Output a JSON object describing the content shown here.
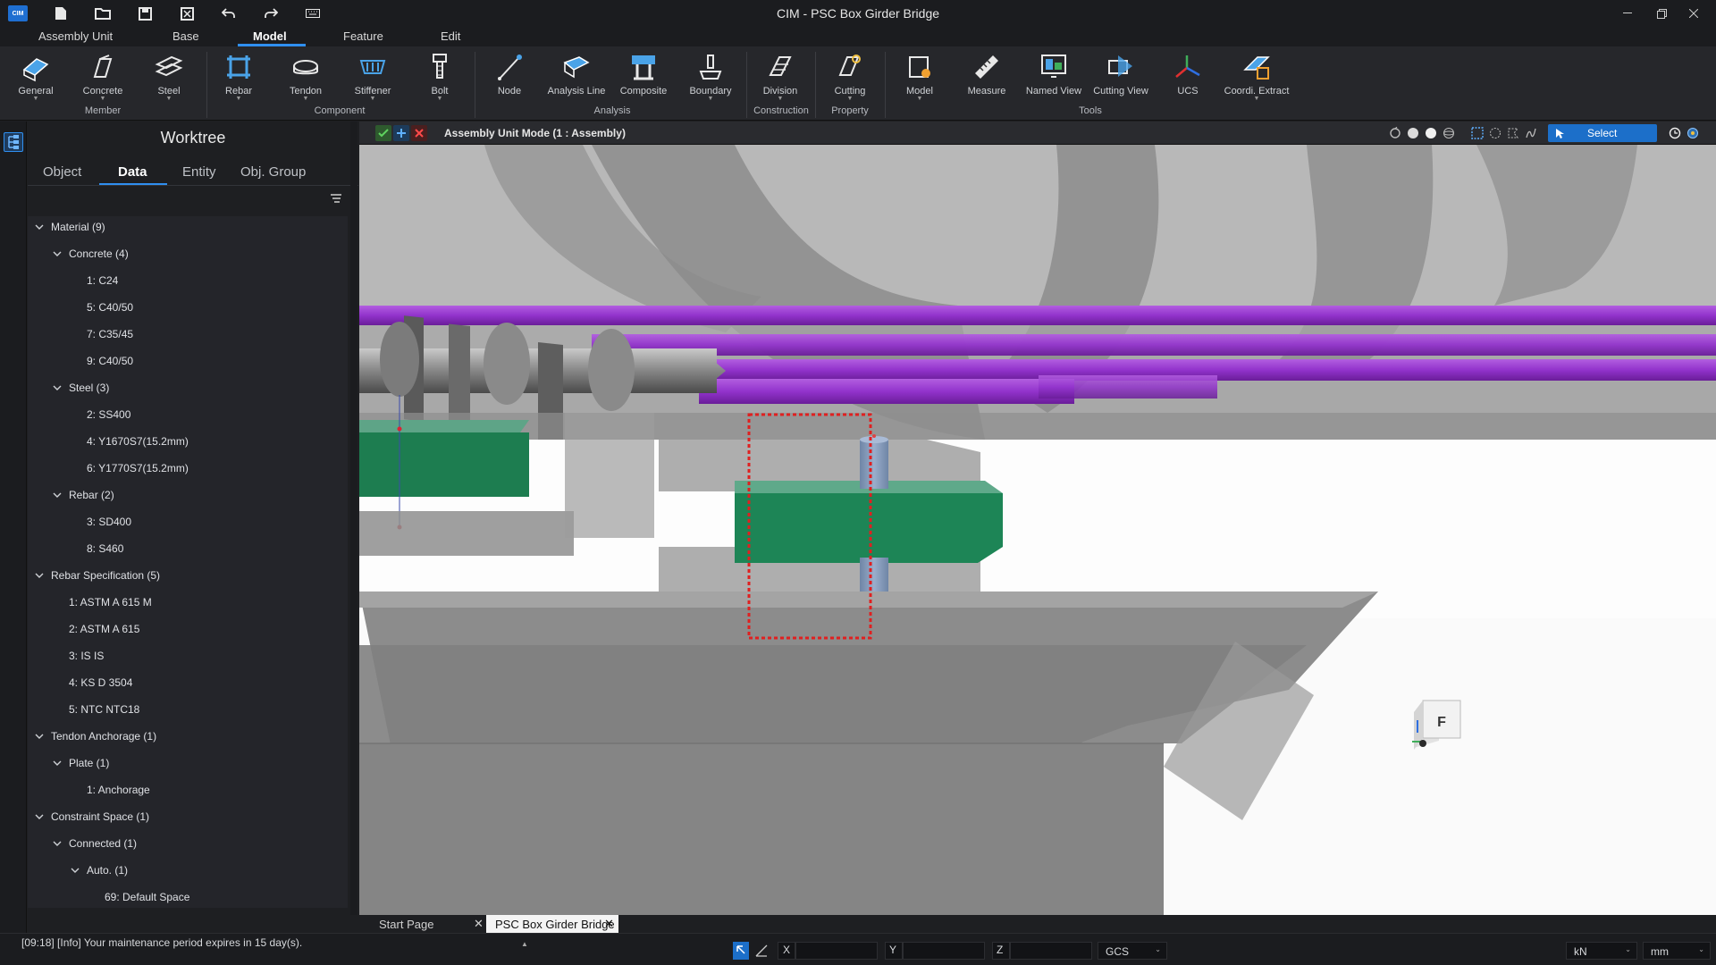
{
  "app": {
    "title": "CIM - PSC Box Girder Bridge",
    "logo": "CIM"
  },
  "menu": {
    "tabs": [
      "Assembly Unit",
      "Base",
      "Model",
      "Feature",
      "Edit"
    ],
    "active": "Model"
  },
  "ribbon": {
    "buttons": [
      "General",
      "Concrete",
      "Steel",
      "Rebar",
      "Tendon",
      "Stiffener",
      "Bolt",
      "Node",
      "Analysis Line",
      "Composite",
      "Boundary",
      "Division",
      "Cutting",
      "Model",
      "Measure",
      "Named View",
      "Cutting View",
      "UCS",
      "Coordi. Extract"
    ],
    "groups": [
      "Member",
      "Component",
      "Analysis",
      "Construction",
      "Property",
      "Tools"
    ]
  },
  "worktree": {
    "title": "Worktree",
    "tabs": [
      "Object",
      "Data",
      "Entity",
      "Obj. Group"
    ],
    "active_tab": "Data",
    "items": [
      {
        "label": "Material (9)",
        "level": 0,
        "expanded": true
      },
      {
        "label": "Concrete (4)",
        "level": 1,
        "expanded": true
      },
      {
        "label": "1: C24",
        "level": 2
      },
      {
        "label": "5: C40/50",
        "level": 2
      },
      {
        "label": "7: C35/45",
        "level": 2
      },
      {
        "label": "9: C40/50",
        "level": 2
      },
      {
        "label": "Steel (3)",
        "level": 1,
        "expanded": true
      },
      {
        "label": "2: SS400",
        "level": 2
      },
      {
        "label": "4: Y1670S7(15.2mm)",
        "level": 2
      },
      {
        "label": "6: Y1770S7(15.2mm)",
        "level": 2
      },
      {
        "label": "Rebar (2)",
        "level": 1,
        "expanded": true
      },
      {
        "label": "3: SD400",
        "level": 2
      },
      {
        "label": "8: S460",
        "level": 2
      },
      {
        "label": "Rebar Specification (5)",
        "level": 0,
        "expanded": true
      },
      {
        "label": "1: ASTM A 615 M",
        "level": 1
      },
      {
        "label": "2: ASTM A 615",
        "level": 1
      },
      {
        "label": "3: IS IS",
        "level": 1
      },
      {
        "label": "4: KS D 3504",
        "level": 1
      },
      {
        "label": "5: NTC NTC18",
        "level": 1
      },
      {
        "label": "Tendon Anchorage (1)",
        "level": 0,
        "expanded": true
      },
      {
        "label": "Plate (1)",
        "level": 1,
        "expanded": true
      },
      {
        "label": "1: Anchorage",
        "level": 2
      },
      {
        "label": "Constraint Space (1)",
        "level": 0,
        "expanded": true
      },
      {
        "label": "Connected (1)",
        "level": 1,
        "expanded": true
      },
      {
        "label": "Auto. (1)",
        "level": 2,
        "expanded": true
      },
      {
        "label": "69: Default Space",
        "level": 3
      }
    ]
  },
  "viewport": {
    "mode_label": "Assembly Unit Mode (1 : Assembly)",
    "select_label": "Select",
    "cube_label": "F"
  },
  "doc_tabs": [
    {
      "label": "Start Page",
      "active": false
    },
    {
      "label": "PSC Box Girder Bridge",
      "active": true
    }
  ],
  "status": {
    "message": "[09:18] [Info] Your maintenance period expires in 15 day(s).",
    "x_label": "X",
    "y_label": "Y",
    "z_label": "Z",
    "coord_system": "GCS",
    "force_unit": "kN",
    "length_unit": "mm"
  },
  "colors": {
    "accent": "#2f8ff0",
    "tendon": "#9b3fcf",
    "bearing": "#1f8a5c",
    "selection": "#e02020"
  }
}
